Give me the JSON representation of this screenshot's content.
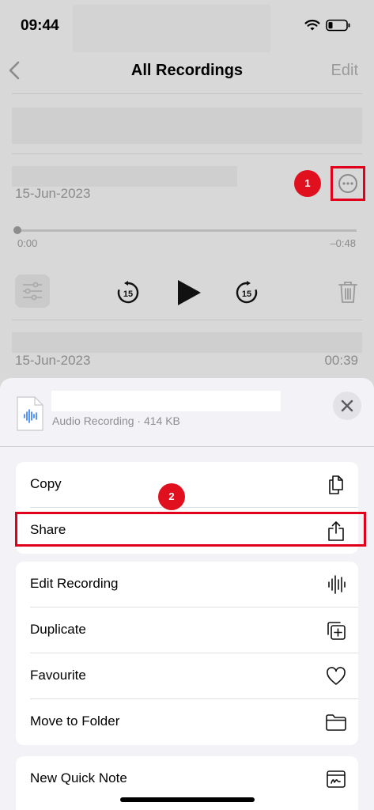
{
  "status_bar": {
    "time": "09:44"
  },
  "nav": {
    "title": "All Recordings",
    "edit_label": "Edit"
  },
  "recording_1": {
    "date": "15-Jun-2023",
    "elapsed": "0:00",
    "remaining": "–0:48",
    "skip_seconds": "15"
  },
  "recording_2": {
    "date": "15-Jun-2023",
    "duration": "00:39"
  },
  "markers": {
    "step_1": "1",
    "step_2": "2"
  },
  "sheet": {
    "subtitle": "Audio Recording · 414 KB",
    "group_1": [
      {
        "label": "Copy",
        "icon": "copy-icon"
      },
      {
        "label": "Share",
        "icon": "share-icon"
      }
    ],
    "group_2": [
      {
        "label": "Edit Recording",
        "icon": "waveform-icon"
      },
      {
        "label": "Duplicate",
        "icon": "duplicate-icon"
      },
      {
        "label": "Favourite",
        "icon": "heart-icon"
      },
      {
        "label": "Move to Folder",
        "icon": "folder-icon"
      }
    ],
    "group_3": [
      {
        "label": "New Quick Note",
        "icon": "quick-note-icon"
      }
    ]
  },
  "colors": {
    "highlight": "#e0001b",
    "accent_blue": "#2f7cf6"
  }
}
